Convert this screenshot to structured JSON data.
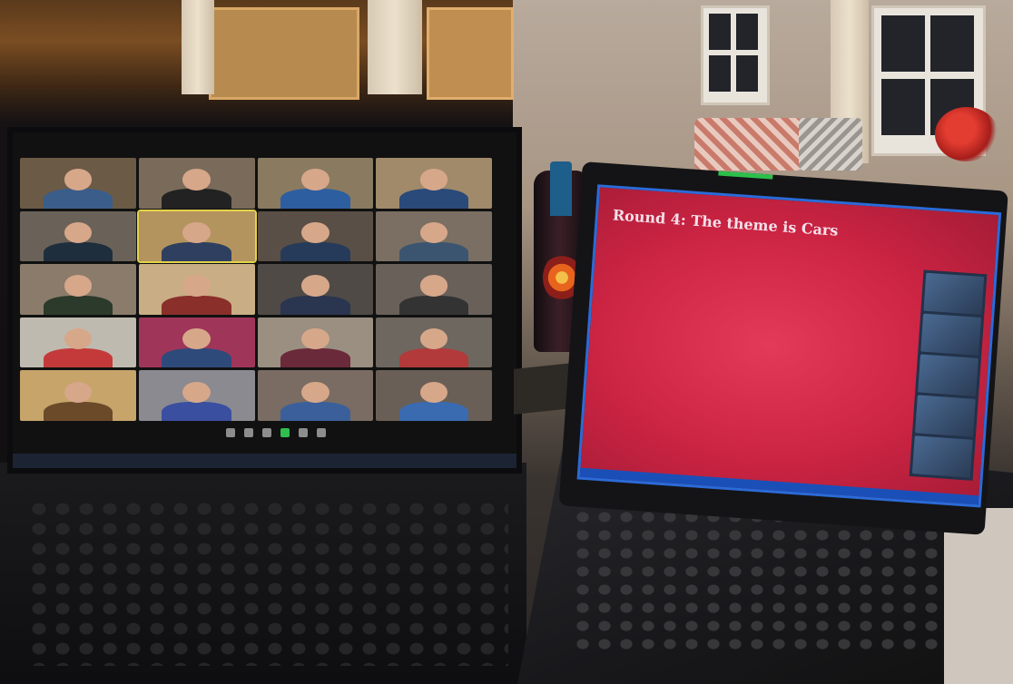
{
  "slide": {
    "title": "Round 4: The theme is Cars"
  },
  "colors": {
    "slide_background": "#cc2443",
    "slide_border": "#2b6bd8",
    "zoom_active_border": "#e3d24a",
    "windows_taskbar": "#1a4fb8"
  },
  "zoom_gallery": {
    "participant_tiles": 20,
    "active_speaker_tile": 6
  }
}
